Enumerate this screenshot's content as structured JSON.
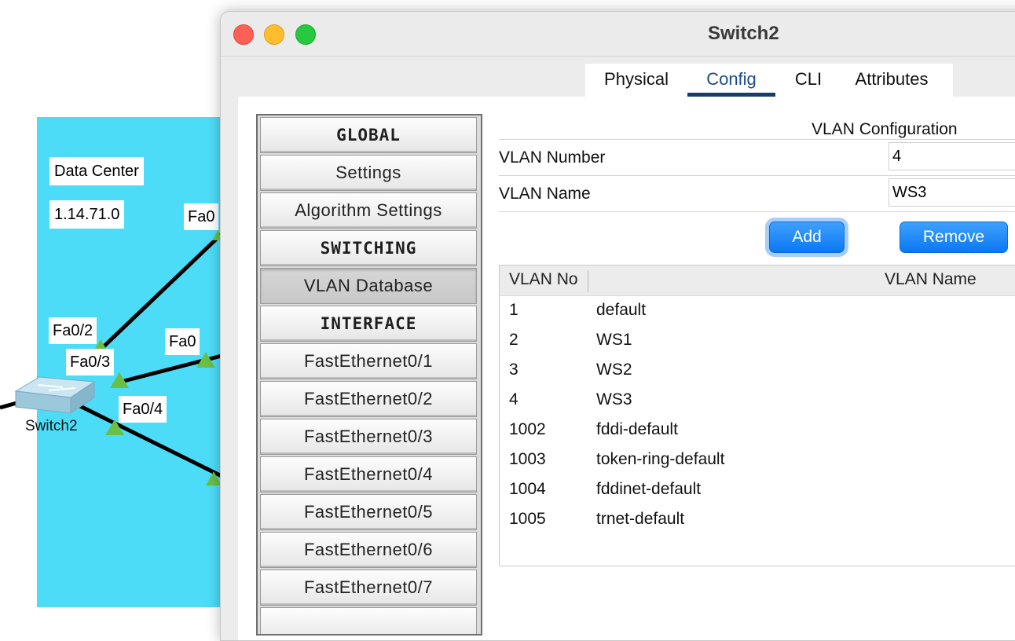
{
  "topology": {
    "area_label": "Data Center",
    "area_ip": "1.14.71.0",
    "device_name": "Switch2",
    "ports": {
      "p1": "Fa0/2",
      "p2": "Fa0/3",
      "p3": "Fa0/4",
      "p4": "Fa0",
      "p5": "Fa0"
    },
    "area_color": "#4ddcf8",
    "link_color": "#000000",
    "port_up_color": "#6abf45"
  },
  "window": {
    "title": "Switch2",
    "tabs": [
      "Physical",
      "Config",
      "CLI",
      "Attributes"
    ],
    "active_tab": "Config"
  },
  "nav": {
    "items": [
      {
        "label": "GLOBAL",
        "type": "header"
      },
      {
        "label": "Settings",
        "type": "item"
      },
      {
        "label": "Algorithm Settings",
        "type": "item"
      },
      {
        "label": "SWITCHING",
        "type": "header"
      },
      {
        "label": "VLAN Database",
        "type": "item",
        "selected": true
      },
      {
        "label": "INTERFACE",
        "type": "header"
      },
      {
        "label": "FastEthernet0/1",
        "type": "item"
      },
      {
        "label": "FastEthernet0/2",
        "type": "item"
      },
      {
        "label": "FastEthernet0/3",
        "type": "item"
      },
      {
        "label": "FastEthernet0/4",
        "type": "item"
      },
      {
        "label": "FastEthernet0/5",
        "type": "item"
      },
      {
        "label": "FastEthernet0/6",
        "type": "item"
      },
      {
        "label": "FastEthernet0/7",
        "type": "item"
      }
    ]
  },
  "vlan_config": {
    "title": "VLAN Configuration",
    "number_label": "VLAN Number",
    "number_value": "4",
    "name_label": "VLAN Name",
    "name_value": "WS3",
    "add_label": "Add",
    "remove_label": "Remove",
    "table": {
      "col_no": "VLAN No",
      "col_name": "VLAN Name",
      "rows": [
        {
          "no": "1",
          "name": "default"
        },
        {
          "no": "2",
          "name": "WS1"
        },
        {
          "no": "3",
          "name": "WS2"
        },
        {
          "no": "4",
          "name": "WS3"
        },
        {
          "no": "1002",
          "name": "fddi-default"
        },
        {
          "no": "1003",
          "name": "token-ring-default"
        },
        {
          "no": "1004",
          "name": "fddinet-default"
        },
        {
          "no": "1005",
          "name": "trnet-default"
        }
      ]
    },
    "button_color": "#0a78f2"
  }
}
